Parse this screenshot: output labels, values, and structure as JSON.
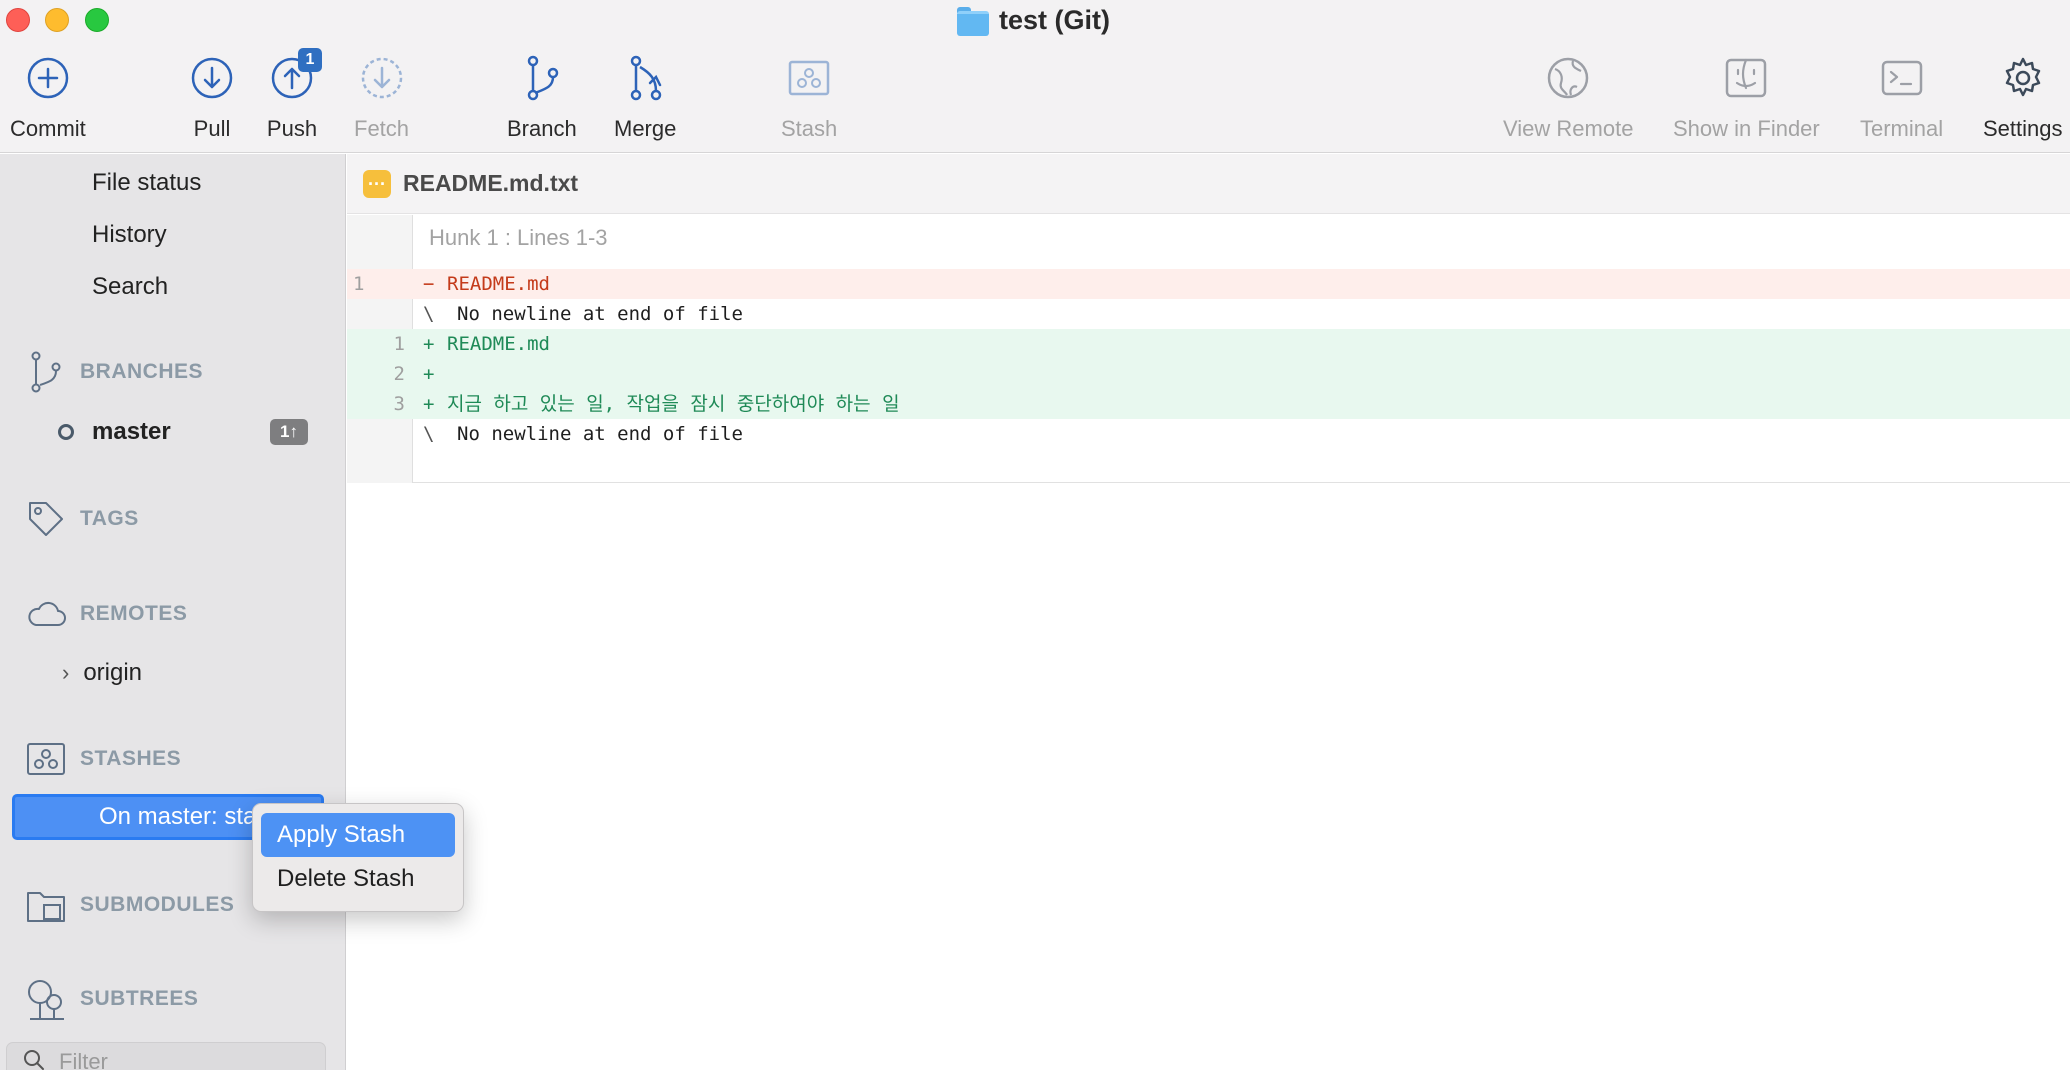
{
  "window": {
    "title": "test (Git)"
  },
  "toolbar": {
    "commit": "Commit",
    "pull": "Pull",
    "push": "Push",
    "push_badge": "1",
    "fetch": "Fetch",
    "branch": "Branch",
    "merge": "Merge",
    "stash": "Stash",
    "view_remote": "View Remote",
    "show_in_finder": "Show in Finder",
    "terminal": "Terminal",
    "settings": "Settings"
  },
  "sidebar": {
    "nav": [
      "File status",
      "History",
      "Search"
    ],
    "branches_heading": "BRANCHES",
    "branch": {
      "name": "master",
      "badge": "1↑"
    },
    "tags_heading": "TAGS",
    "remotes_heading": "REMOTES",
    "remote": {
      "name": "origin"
    },
    "stashes_heading": "STASHES",
    "stash_item": "On master: stash",
    "submodules_heading": "SUBMODULES",
    "subtrees_heading": "SUBTREES",
    "filter_placeholder": "Filter"
  },
  "file": {
    "name": "README.md.txt",
    "status_glyph": "···"
  },
  "diff": {
    "hunk_header": "Hunk 1 : Lines 1-3",
    "lines": [
      {
        "old": "1",
        "new": "",
        "marker": "−",
        "text": "README.md"
      },
      {
        "old": "",
        "new": "",
        "marker": "\\",
        "text": "No newline at end of file"
      },
      {
        "old": "",
        "new": "1",
        "marker": "+",
        "text": "README.md"
      },
      {
        "old": "",
        "new": "2",
        "marker": "+",
        "text": ""
      },
      {
        "old": "",
        "new": "3",
        "marker": "+",
        "text": "지금 하고 있는 일, 작업을 잠시 중단하여야 하는 일"
      },
      {
        "old": "",
        "new": "",
        "marker": "\\",
        "text": "No newline at end of file"
      }
    ]
  },
  "context_menu": {
    "apply": "Apply Stash",
    "delete": "Delete Stash"
  },
  "colors": {
    "accent": "#4d90f4",
    "deleted_bg": "#feeeeb",
    "added_bg": "#e8f8ef",
    "deleted_text": "#c43a1a",
    "added_text": "#1f8a57"
  }
}
